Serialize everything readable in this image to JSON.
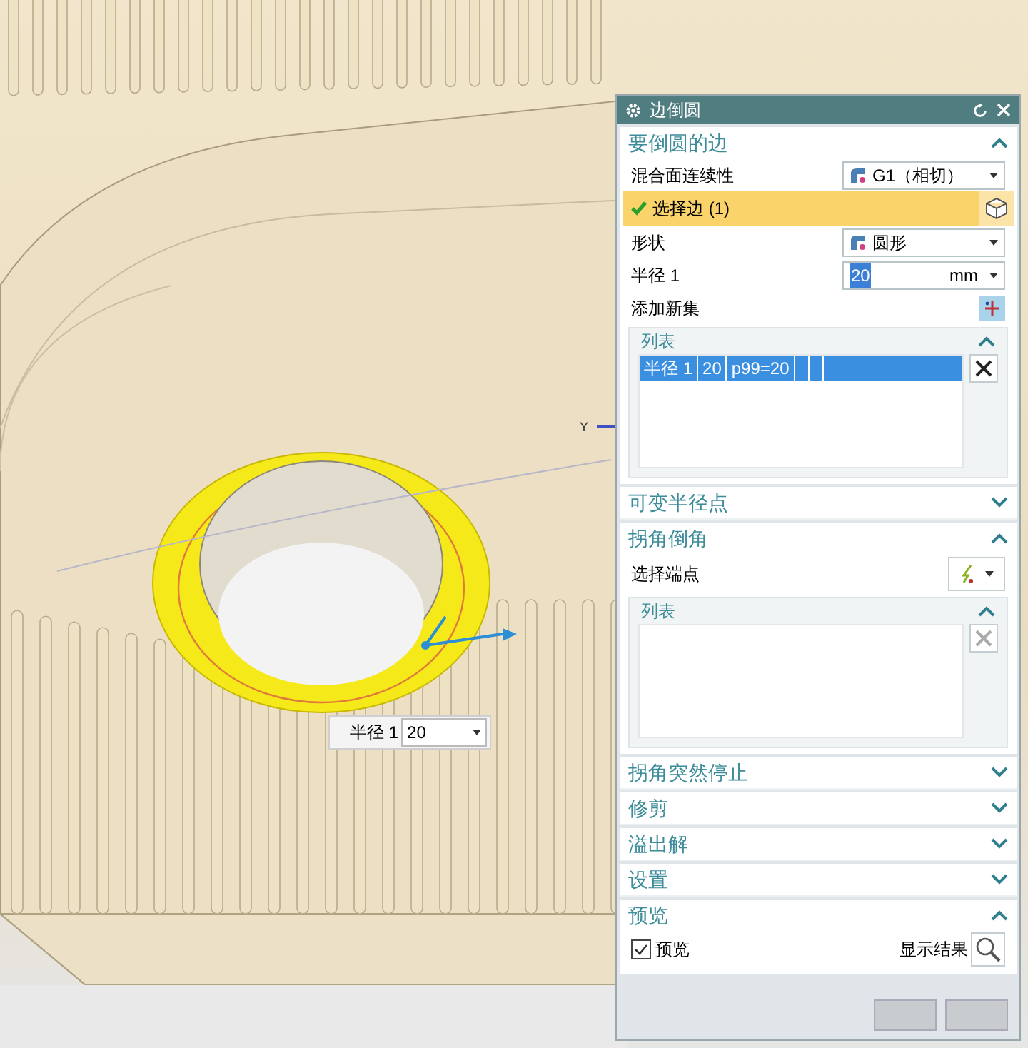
{
  "viewport": {
    "axis_label": "Y",
    "radius_input": {
      "label": "半径 1",
      "value": "20"
    }
  },
  "dialog": {
    "title": "边倒圆",
    "sections": [
      {
        "kind": "edges",
        "title": "要倒圆的边",
        "expanded": true,
        "continuity": {
          "label": "混合面连续性",
          "value": "G1（相切）"
        },
        "select": {
          "label": "选择边 (1)",
          "checked": true
        },
        "shape": {
          "label": "形状",
          "value": "圆形"
        },
        "radius": {
          "label": "半径 1",
          "value": "20",
          "unit": "mm"
        },
        "add_set": {
          "label": "添加新集"
        },
        "list": {
          "title": "列表",
          "expanded": true,
          "rows": [
            {
              "cells": [
                "半径 1",
                "20",
                "p99=20"
              ],
              "selected": true
            }
          ]
        }
      },
      {
        "kind": "plain",
        "title": "可变半径点",
        "expanded": false
      },
      {
        "kind": "corner",
        "title": "拐角倒角",
        "expanded": true,
        "select_label": "选择端点",
        "list": {
          "title": "列表",
          "expanded": true
        }
      },
      {
        "kind": "plain",
        "title": "拐角突然停止",
        "expanded": false
      },
      {
        "kind": "plain",
        "title": "修剪",
        "expanded": false
      },
      {
        "kind": "plain",
        "title": "溢出解",
        "expanded": false
      },
      {
        "kind": "plain",
        "title": "设置",
        "expanded": false
      },
      {
        "kind": "preview",
        "title": "预览",
        "expanded": true,
        "checkbox": {
          "label": "预览",
          "checked": true
        },
        "show_result": "显示结果"
      }
    ]
  }
}
